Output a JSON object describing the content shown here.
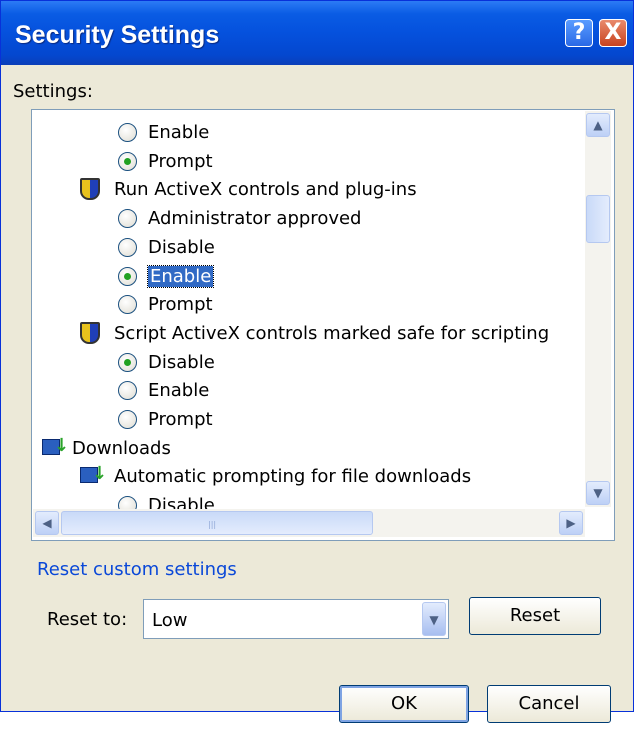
{
  "window": {
    "title": "Security Settings"
  },
  "titlebar_buttons": {
    "help": "?",
    "close": "X"
  },
  "settings_label": "Settings:",
  "tree_items": [
    {
      "type": "radio",
      "label": "Enable",
      "checked": false
    },
    {
      "type": "radio",
      "label": "Prompt",
      "checked": true
    },
    {
      "type": "setting",
      "icon": "shield-icon",
      "label": "Run ActiveX controls and plug-ins"
    },
    {
      "type": "radio",
      "label": "Administrator approved",
      "checked": false
    },
    {
      "type": "radio",
      "label": "Disable",
      "checked": false
    },
    {
      "type": "radio",
      "label": "Enable",
      "checked": true,
      "selected": true
    },
    {
      "type": "radio",
      "label": "Prompt",
      "checked": false
    },
    {
      "type": "setting",
      "icon": "shield-icon",
      "label": "Script ActiveX controls marked safe for scripting"
    },
    {
      "type": "radio",
      "label": "Disable",
      "checked": true
    },
    {
      "type": "radio",
      "label": "Enable",
      "checked": false
    },
    {
      "type": "radio",
      "label": "Prompt",
      "checked": false
    },
    {
      "type": "category",
      "icon": "downloads-icon",
      "label": "Downloads"
    },
    {
      "type": "setting",
      "icon": "downloads-icon",
      "label": "Automatic prompting for file downloads"
    },
    {
      "type": "radio",
      "label": "Disable",
      "checked": false
    }
  ],
  "reset_link": "Reset custom settings",
  "reset_to_label": "Reset to:",
  "reset_select": {
    "value": "Low"
  },
  "buttons": {
    "reset": "Reset",
    "ok": "OK",
    "cancel": "Cancel"
  },
  "colors": {
    "titlebar": "#0551dd",
    "dialog_bg": "#ece9d8",
    "selection": "#316ac5",
    "link": "#0a48d8"
  }
}
